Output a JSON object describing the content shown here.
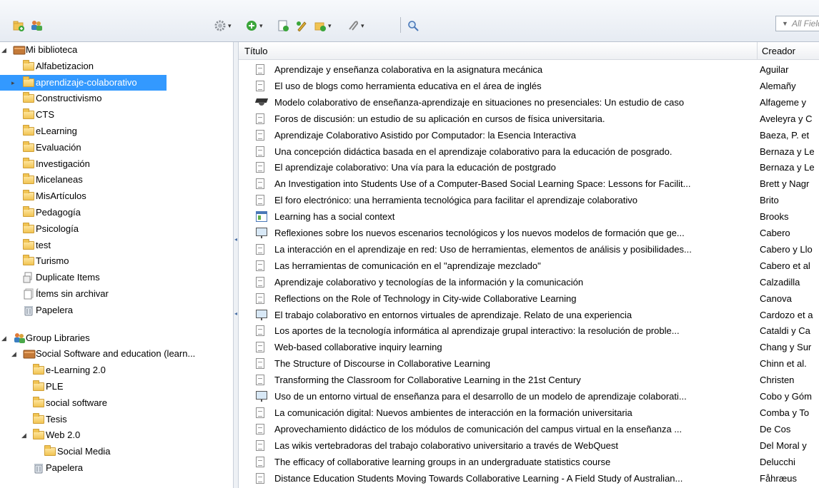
{
  "toolbar": {
    "search_placeholder": "All Fields & Tags",
    "icons": [
      "new-collection-icon",
      "new-group-icon",
      "actions-gear-icon",
      "new-item-icon",
      "new-note-icon",
      "attach-icon",
      "add-by-identifier-icon",
      "related-icon",
      "magnify-icon"
    ]
  },
  "tree": {
    "library": "Mi biblioteca",
    "collections": [
      "Alfabetizacion",
      "aprendizaje-colaborativo",
      "Constructivismo",
      "CTS",
      "eLearning",
      "Evaluación",
      "Investigación",
      "Micelaneas",
      "MisArtículos",
      "Pedagogía",
      "Psicología",
      "test",
      "Turismo"
    ],
    "selected": "aprendizaje-colaborativo",
    "duplicate_items": "Duplicate Items",
    "unfiled_items": "Ítems sin archivar",
    "trash": "Papelera",
    "group_libraries": "Group Libraries",
    "group_name": "Social Software and education (learn...",
    "group_collections": [
      "e-Learning 2.0",
      "PLE",
      "social software",
      "Tesis",
      "Web 2.0"
    ],
    "sub_collection": "Social Media",
    "group_trash": "Papelera"
  },
  "table": {
    "col_title": "Título",
    "col_creator": "Creador",
    "rows": [
      {
        "icon": "doc",
        "title": "Aprendizaje y enseñanza colaborativa en la asignatura mecánica",
        "creator": "Aguilar"
      },
      {
        "icon": "doc",
        "title": "El uso de blogs como herramienta educativa en el área de inglés",
        "creator": "Alemañy"
      },
      {
        "icon": "cap",
        "title": "Modelo colaborativo de enseñanza-aprendizaje en situaciones no presenciales: Un estudio de caso",
        "creator": "Alfageme y"
      },
      {
        "icon": "doc",
        "title": "Foros de discusión: un estudio de su aplicación en cursos de física universitaria.",
        "creator": "Aveleyra y C"
      },
      {
        "icon": "doc",
        "title": "Aprendizaje Colaborativo Asistido por Computador: la Esencia Interactiva",
        "creator": "Baeza, P. et"
      },
      {
        "icon": "doc",
        "title": "Una concepción didáctica basada en el aprendizaje colaborativo para la educación de posgrado.",
        "creator": "Bernaza y Le"
      },
      {
        "icon": "doc",
        "title": "El aprendizaje colaborativo: Una vía para la educación de postgrado",
        "creator": "Bernaza y Le"
      },
      {
        "icon": "doc",
        "title": "An Investigation into Students Use of a Computer-Based Social Learning Space: Lessons for Facilit...",
        "creator": "Brett y Nagr"
      },
      {
        "icon": "doc",
        "title": "El foro electrónico: una herramienta tecnológica para facilitar el aprendizaje colaborativo",
        "creator": "Brito"
      },
      {
        "icon": "web",
        "title": "Learning has a social context",
        "creator": "Brooks"
      },
      {
        "icon": "pres",
        "title": "Reflexiones sobre los nuevos escenarios tecnológicos y  los nuevos modelos de formación que ge...",
        "creator": "Cabero"
      },
      {
        "icon": "doc",
        "title": "La interacción en el aprendizaje en red: Uso de herramientas, elementos de análisis y posibilidades...",
        "creator": "Cabero y Llo"
      },
      {
        "icon": "doc",
        "title": "Las herramientas de comunicación en el \"aprendizaje mezclado\"",
        "creator": "Cabero et al"
      },
      {
        "icon": "doc",
        "title": "Aprendizaje colaborativo y tecnologías de la información y la comunicación",
        "creator": "Calzadilla"
      },
      {
        "icon": "doc",
        "title": "Reflections on the Role of Technology in City-wide Collaborative Learning",
        "creator": "Canova"
      },
      {
        "icon": "pres",
        "title": "El trabajo  colaborativo  en entornos virtuales de aprendizaje. Relato de una experiencia",
        "creator": "Cardozo et a"
      },
      {
        "icon": "doc",
        "title": "Los aportes de la tecnología informática al aprendizaje grupal interactivo: la resolución de proble...",
        "creator": "Cataldi y Ca"
      },
      {
        "icon": "doc",
        "title": "Web-based collaborative inquiry learning",
        "creator": "Chang y Sur"
      },
      {
        "icon": "doc",
        "title": "The Structure of Discourse in Collaborative Learning",
        "creator": "Chinn et al."
      },
      {
        "icon": "doc",
        "title": "Transforming the Classroom for Collaborative Learning in the 21st Century",
        "creator": "Christen"
      },
      {
        "icon": "pres",
        "title": "Uso de un entorno virtual de enseñanza para el desarrollo de un modelo de aprendizaje colaborati...",
        "creator": "Cobo y Góm"
      },
      {
        "icon": "doc",
        "title": "La comunicación digital: Nuevos ambientes de interacción en la formación universitaria",
        "creator": "Comba y To"
      },
      {
        "icon": "doc",
        "title": "Aprovechamiento didáctico de los módulos de comunicación del campus virtual en la enseñanza ...",
        "creator": "De Cos"
      },
      {
        "icon": "doc",
        "title": "Las wikis vertebradoras del trabajo colaborativo universitario a través de WebQuest",
        "creator": "Del Moral y"
      },
      {
        "icon": "doc",
        "title": "The efficacy of collaborative learning groups in an undergraduate statistics course",
        "creator": "Delucchi"
      },
      {
        "icon": "doc",
        "title": "Distance Education Students Moving Towards Collaborative Learning - A Field Study of Australian...",
        "creator": "Fåhræus"
      }
    ]
  }
}
